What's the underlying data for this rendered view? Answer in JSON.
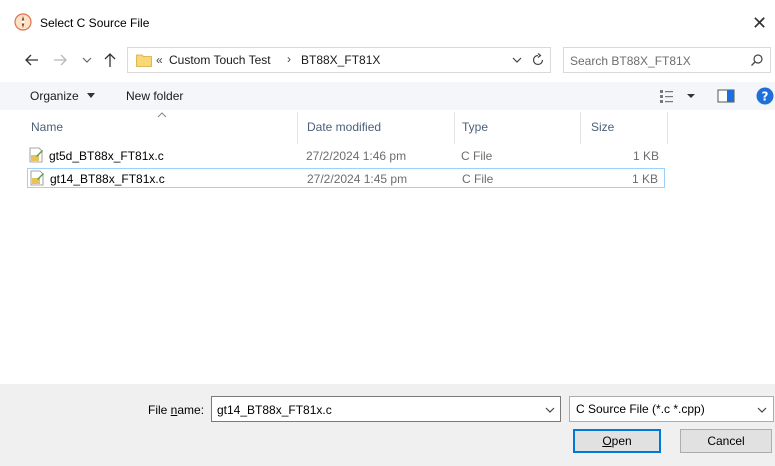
{
  "window": {
    "title": "Select C Source File",
    "close_glyph": "✕"
  },
  "address": {
    "overflow": "«",
    "breadcrumbs": [
      "Custom Touch Test",
      "BT88X_FT81X"
    ],
    "separator": "›"
  },
  "search": {
    "placeholder": "Search BT88X_FT81X"
  },
  "toolbar": {
    "organize_label": "Organize",
    "new_folder_label": "New folder"
  },
  "columns": {
    "name": "Name",
    "date": "Date modified",
    "type": "Type",
    "size": "Size"
  },
  "files": [
    {
      "name": "gt5d_BT88x_FT81x.c",
      "date": "27/2/2024 1:46 pm",
      "type": "C File",
      "size": "1 KB",
      "selected": false
    },
    {
      "name": "gt14_BT88x_FT81x.c",
      "date": "27/2/2024 1:45 pm",
      "type": "C File",
      "size": "1 KB",
      "selected": true
    }
  ],
  "bottom": {
    "filename_label_pre": "File ",
    "filename_label_access": "n",
    "filename_label_post": "ame:",
    "filename_value": "gt14_BT88x_FT81x.c",
    "filter_value": "C Source File (*.c *.cpp)",
    "open_label_access": "O",
    "open_label_rest": "pen",
    "cancel_label": "Cancel"
  },
  "colors": {
    "accent": "#0078d7",
    "selection_border": "#99d1ff",
    "header_text": "#4c607a",
    "help_blue": "#1e6fd9",
    "folder_yellow": "#f8d775"
  },
  "icons": {
    "app": "app-logo-icon",
    "back": "arrow-left-icon",
    "forward": "arrow-right-icon",
    "recent": "chevron-down-icon",
    "up": "arrow-up-icon",
    "folder": "folder-icon",
    "refresh": "refresh-icon",
    "search": "search-icon",
    "view": "view-options-icon",
    "preview_pane": "preview-pane-icon",
    "help": "help-icon",
    "file": "c-file-icon"
  }
}
